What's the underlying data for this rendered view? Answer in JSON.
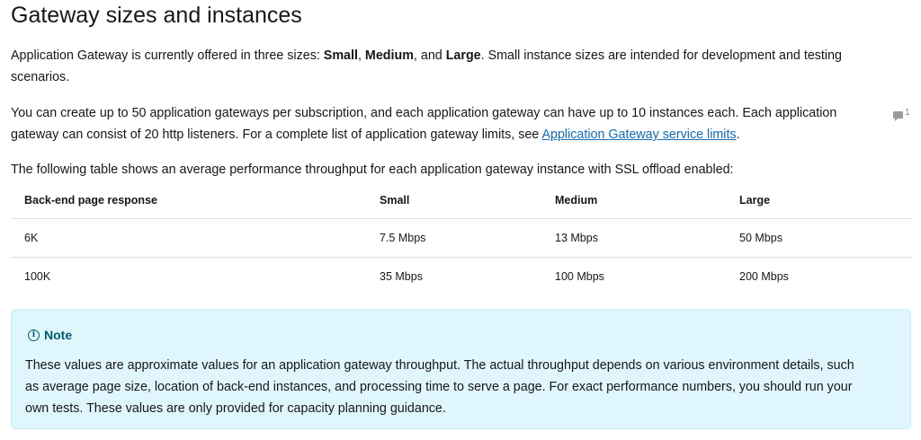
{
  "heading": "Gateway sizes and instances",
  "intro": {
    "before": "Application Gateway is currently offered in three sizes: ",
    "size_small": "Small",
    "sep1": ", ",
    "size_medium": "Medium",
    "sep2": ", and ",
    "size_large": "Large",
    "after": ". Small instance sizes are intended for development and testing scenarios."
  },
  "limits": {
    "text": "You can create up to 50 application gateways per subscription, and each application gateway can have up to 10 instances each. Each application gateway can consist of 20 http listeners. For a complete list of application gateway limits, see ",
    "link_text": "Application Gateway service limits",
    "after": "."
  },
  "comment_count": "1",
  "table_intro": "The following table shows an average performance throughput for each application gateway instance with SSL offload enabled:",
  "table": {
    "headers": [
      "Back-end page response",
      "Small",
      "Medium",
      "Large"
    ],
    "rows": [
      [
        "6K",
        "7.5 Mbps",
        "13 Mbps",
        "50 Mbps"
      ],
      [
        "100K",
        "35 Mbps",
        "100 Mbps",
        "200 Mbps"
      ]
    ]
  },
  "note": {
    "title": "Note",
    "icon": "info-icon",
    "body": "These values are approximate values for an application gateway throughput. The actual throughput depends on various environment details, such as average page size, location of back-end instances, and processing time to serve a page. For exact performance numbers, you should run your own tests. These values are only provided for capacity planning guidance."
  }
}
